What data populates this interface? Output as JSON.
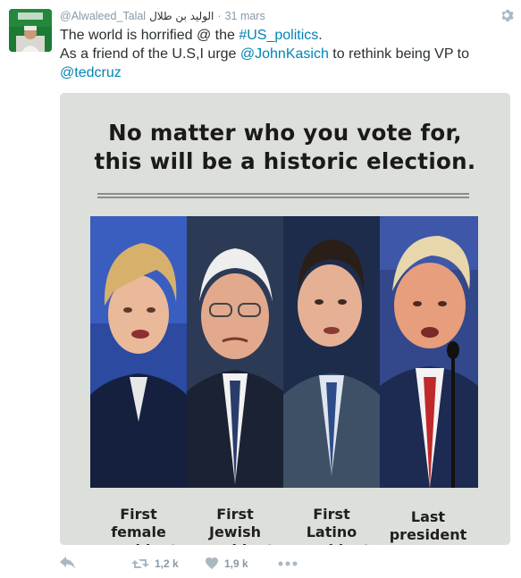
{
  "tweet": {
    "handle": "@Alwaleed_Talal",
    "display_name": "الوليد بن طلال",
    "separator": "·",
    "timestamp": "31 mars",
    "text": {
      "line1_prefix": "The world is horrified @ the ",
      "line1_hashtag": "#US_politics",
      "line1_suffix": ".",
      "line2_prefix": "As a friend of the U.S,I urge ",
      "line2_mention": "@JohnKasich",
      "line2_suffix": " to rethink being VP to",
      "line3_mention": "@tedcruz"
    },
    "icons": {
      "avatar": "avatar-flag-portrait",
      "settings": "gear-icon",
      "reply": "reply-icon",
      "retweet": "retweet-icon",
      "like": "heart-icon",
      "more": "more-icon"
    },
    "colors": {
      "link": "#0084b4",
      "meta": "#8899a6",
      "icon": "#aab8c2",
      "text": "#292f33"
    }
  },
  "media": {
    "headline_line1": "No matter who you vote for,",
    "headline_line2": "this will be a historic election.",
    "captions": [
      {
        "line1": "First",
        "line2": "female",
        "line3": "president"
      },
      {
        "line1": "First",
        "line2": "Jewish",
        "line3": "president"
      },
      {
        "line1": "First",
        "line2": "Latino",
        "line3": "president"
      },
      {
        "line1": "Last",
        "line2": "president",
        "line3": ""
      }
    ]
  },
  "actions": {
    "retweet_count": "1,2 k",
    "like_count": "1,9 k"
  }
}
